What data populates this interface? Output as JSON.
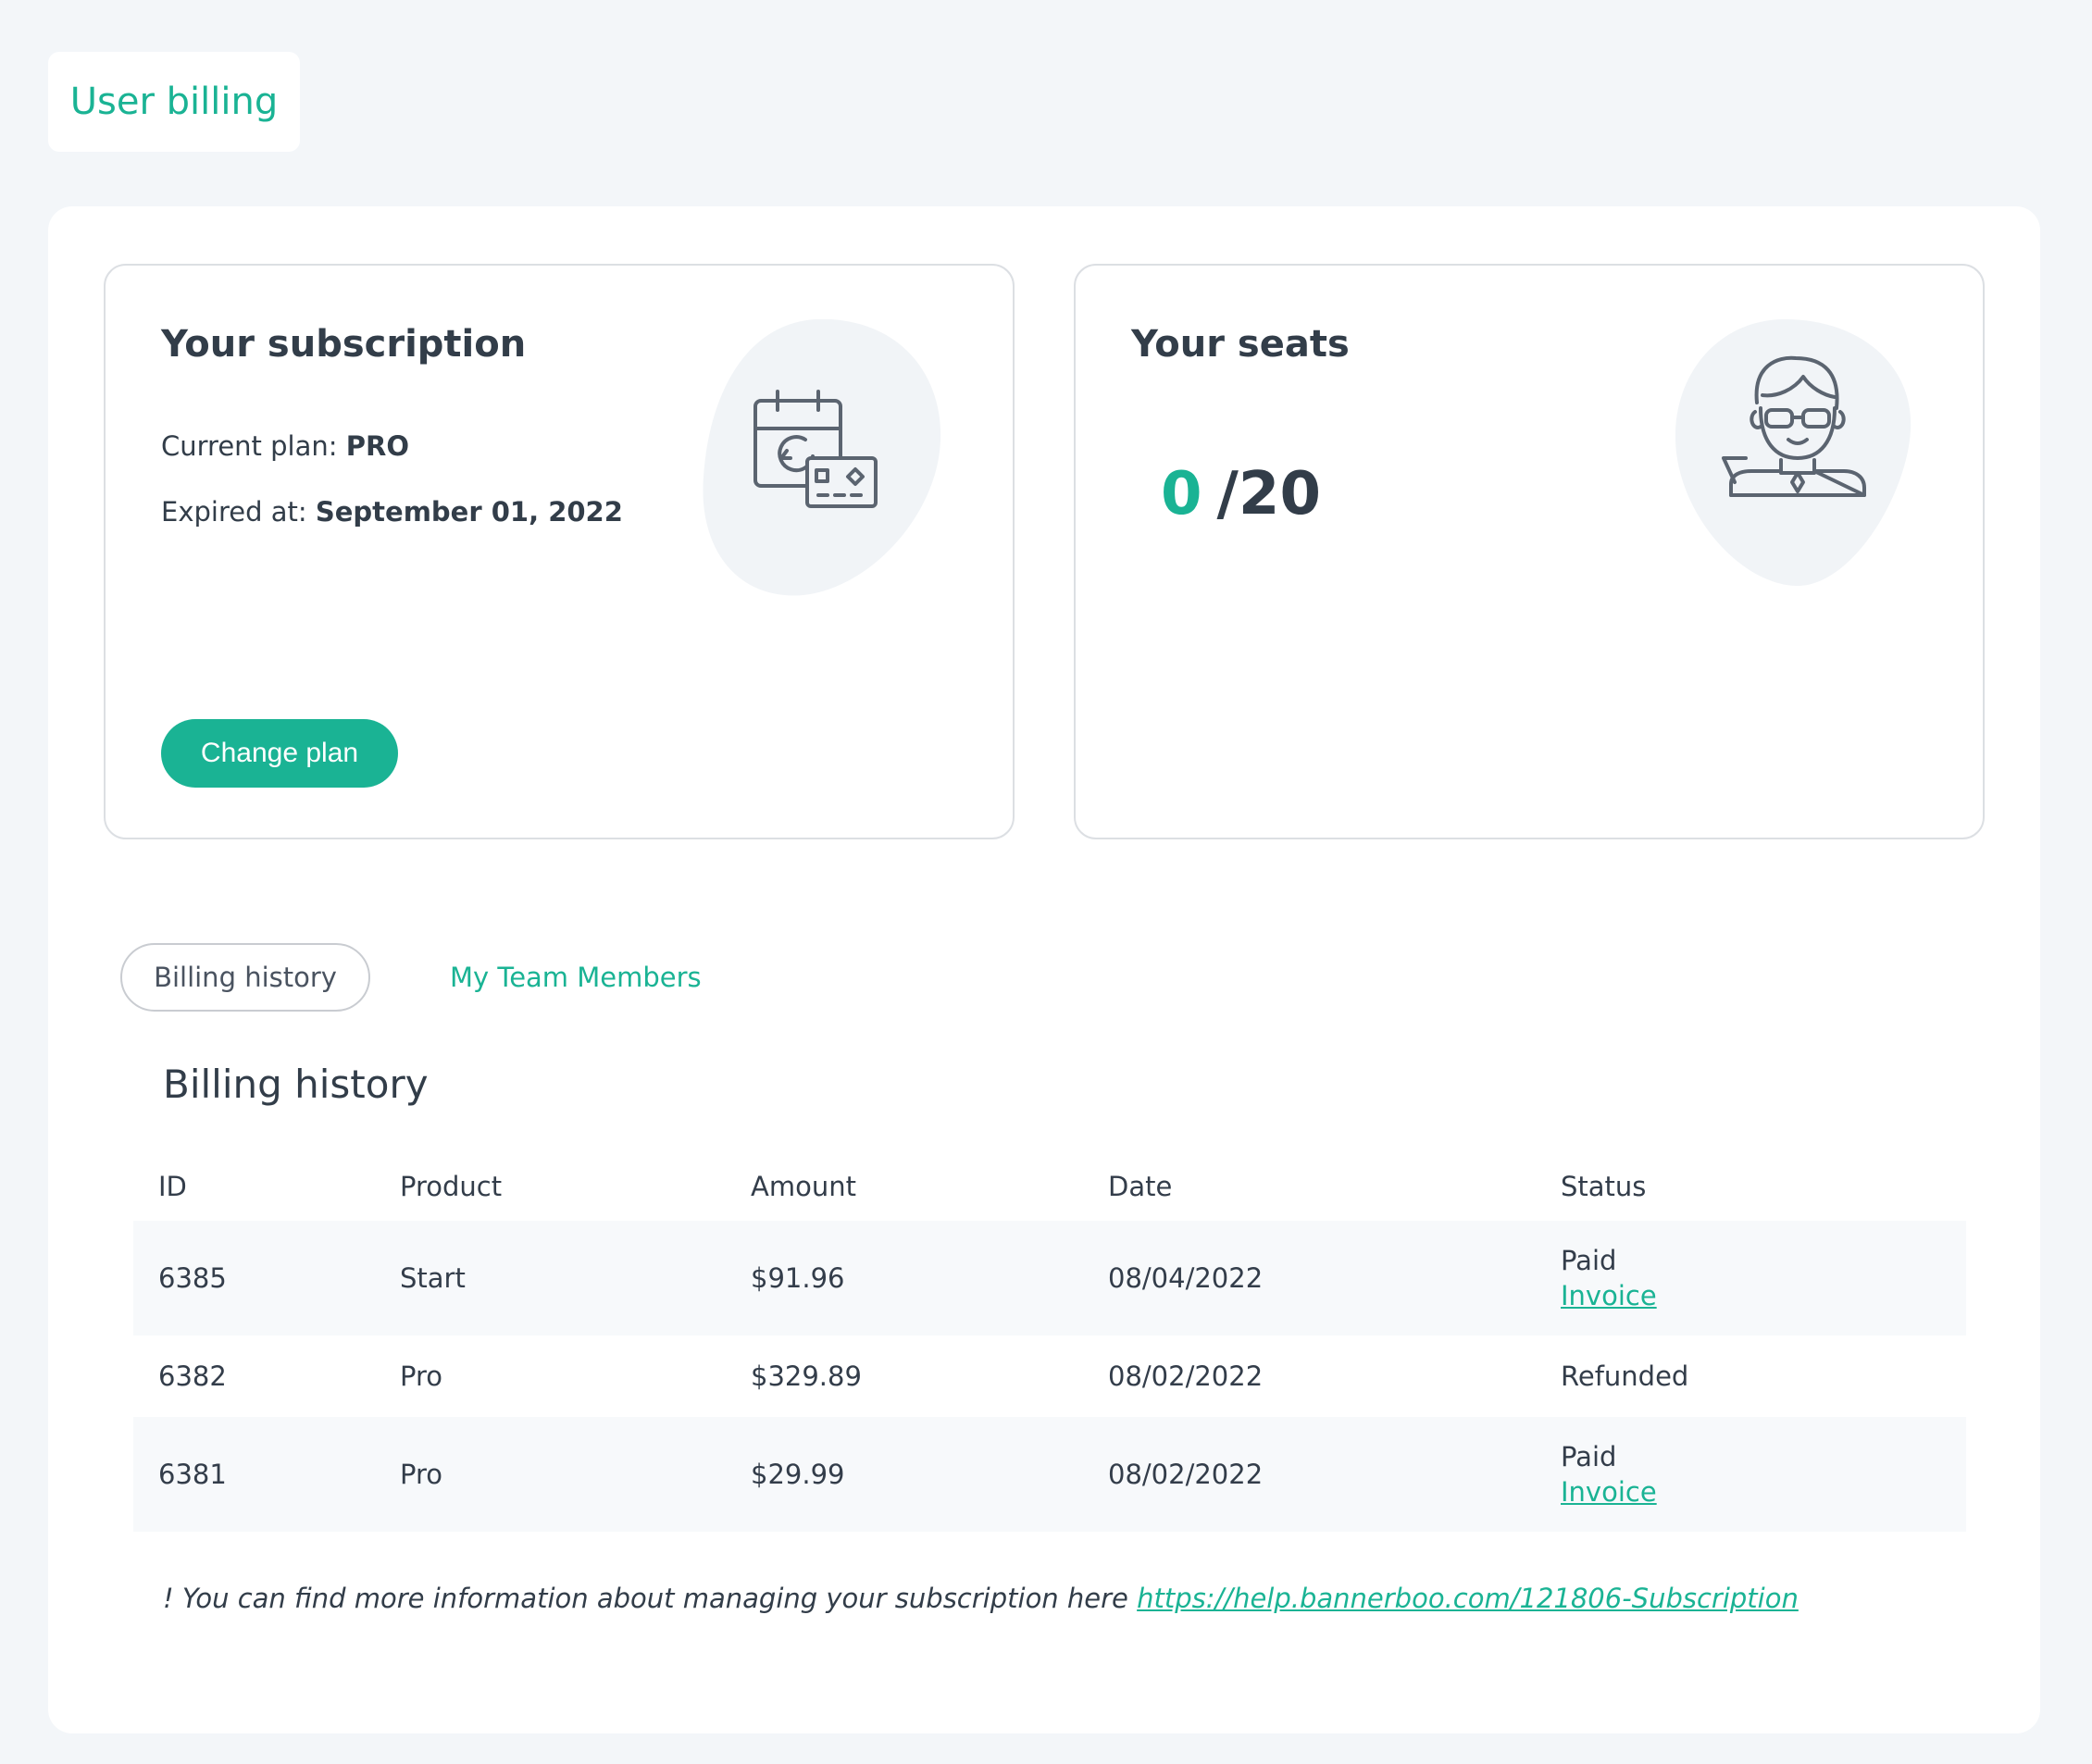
{
  "page": {
    "tab_label": "User billing"
  },
  "subscription": {
    "title": "Your subscription",
    "plan_label": "Current plan: ",
    "plan_value": "PRO",
    "expires_label": "Expired at: ",
    "expires_value": "September 01, 2022",
    "change_plan_label": "Change plan",
    "illustration_icon": "calendar-card-icon"
  },
  "seats": {
    "title": "Your seats",
    "used": "0",
    "total": "/20",
    "illustration_icon": "user-avatar-icon"
  },
  "tabs": {
    "billing_history": "Billing history",
    "team_members": "My Team Members"
  },
  "billing": {
    "title": "Billing history",
    "columns": [
      "ID",
      "Product",
      "Amount",
      "Date",
      "Status"
    ],
    "rows": [
      {
        "id": "6385",
        "product": "Start",
        "amount": "$91.96",
        "date": "08/04/2022",
        "status": "Paid",
        "invoice": "Invoice"
      },
      {
        "id": "6382",
        "product": "Pro",
        "amount": "$329.89",
        "date": "08/02/2022",
        "status": "Refunded",
        "invoice": ""
      },
      {
        "id": "6381",
        "product": "Pro",
        "amount": "$29.99",
        "date": "08/02/2022",
        "status": "Paid",
        "invoice": "Invoice"
      }
    ]
  },
  "note": {
    "text": "! You can find more information about managing your subscription here ",
    "link": "https://help.bannerboo.com/121806-Subscription"
  },
  "colors": {
    "accent": "#1ab394",
    "text": "#323d49",
    "background": "#f3f6f9",
    "blob": "#f1f4f7"
  }
}
